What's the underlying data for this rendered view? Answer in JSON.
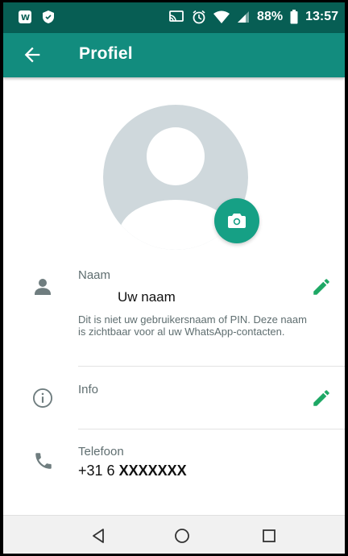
{
  "status_bar": {
    "battery": "88%",
    "time": "13:57",
    "icons": [
      "app-w-icon",
      "shield-icon",
      "cast-icon",
      "alarm-icon",
      "wifi-icon",
      "signal-icon",
      "battery-icon"
    ]
  },
  "app_bar": {
    "title": "Profiel",
    "back_icon": "arrow-back-icon"
  },
  "profile": {
    "avatar_icon": "default-avatar-icon",
    "camera_icon": "camera-icon"
  },
  "name_row": {
    "label": "Naam",
    "value": "Uw naam",
    "hint": "Dit is niet uw gebruikersnaam of PIN. Deze naam is zichtbaar voor al uw WhatsApp-contacten."
  },
  "info_row": {
    "label": "Info"
  },
  "phone_row": {
    "label": "Telefoon",
    "prefix": "+31 6",
    "number": "XXXXXXX"
  },
  "colors": {
    "status_bar": "#075e54",
    "app_bar": "#128c7e",
    "accent": "#16a085",
    "edit": "#1ea865"
  },
  "nav": [
    "back-triangle-icon",
    "home-circle-icon",
    "recents-square-icon"
  ]
}
